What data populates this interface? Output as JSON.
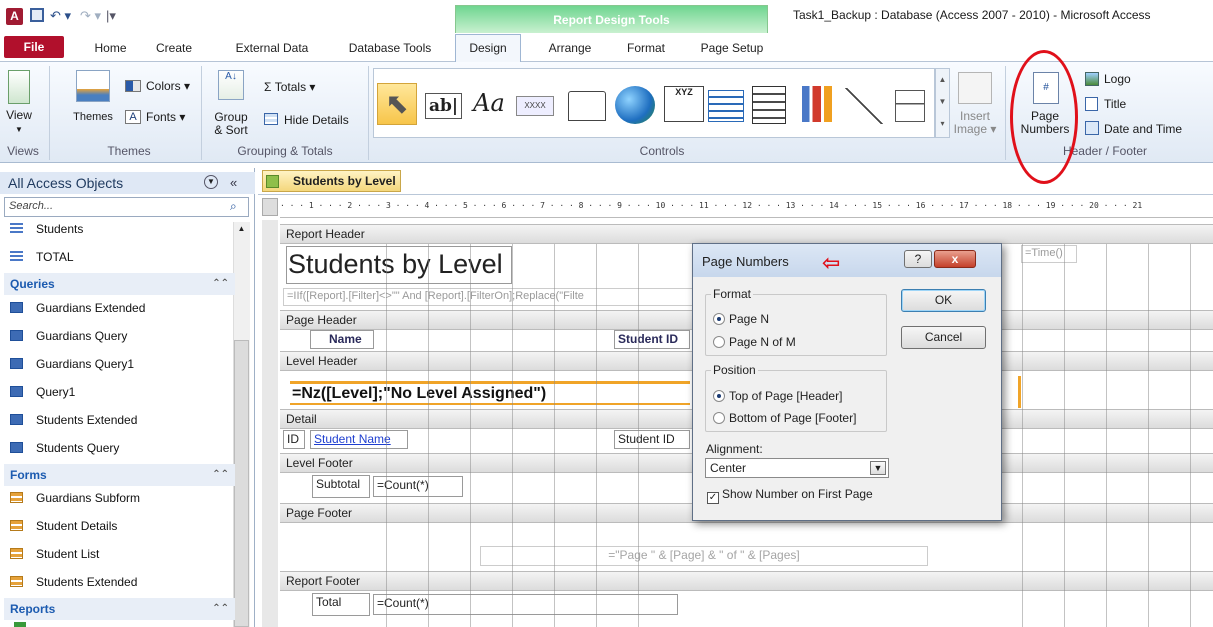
{
  "titlebar": {
    "app_icon": "access-app-icon",
    "qat_icons": [
      "save-icon",
      "undo-icon",
      "redo-icon",
      "customize-icon"
    ],
    "context_group": "Report Design Tools",
    "window_title": "Task1_Backup : Database (Access 2007 - 2010)  -  Microsoft Access"
  },
  "tabs": [
    "File",
    "Home",
    "Create",
    "External Data",
    "Database Tools",
    "Design",
    "Arrange",
    "Format",
    "Page Setup"
  ],
  "ribbon": {
    "views": {
      "view_label": "View",
      "group": "Views"
    },
    "themes": {
      "themes_label": "Themes",
      "colors_label": "Colors ▾",
      "fonts_label": "Fonts ▾",
      "group": "Themes"
    },
    "grouping": {
      "group_sort_label1": "Group",
      "group_sort_label2": "& Sort",
      "totals_label": "Σ Totals ▾",
      "hide_details_label": "Hide Details",
      "group": "Grouping & Totals"
    },
    "controls": {
      "textbox_label": "ab|",
      "label_label": "Aa",
      "button_label": "XXXX",
      "group": "Controls",
      "insert_image1": "Insert",
      "insert_image2": "Image ▾"
    },
    "header_footer": {
      "page_numbers1": "Page",
      "page_numbers2": "Numbers",
      "logo": "Logo",
      "title": "Title",
      "date_time": "Date and Time",
      "group": "Header / Footer"
    }
  },
  "nav": {
    "header": "All Access Objects",
    "search_placeholder": "Search...",
    "tables_items": [
      "Students",
      "TOTAL"
    ],
    "queries_label": "Queries",
    "queries_items": [
      "Guardians Extended",
      "Guardians Query",
      "Guardians Query1",
      "Query1",
      "Students Extended",
      "Students Query"
    ],
    "forms_label": "Forms",
    "forms_items": [
      "Guardians Subform",
      "Student Details",
      "Student List",
      "Students Extended"
    ],
    "reports_label": "Reports"
  },
  "document": {
    "tab_label": "Students by Level",
    "ruler_text": "· · · 1 · · · 2 · · · 3 · · · 4 · · · 5 · · · 6 · · · 7 · · · 8 · · · 9 · · · 10 · · · 11 · · · 12 · · · 13 · · · 14 · · · 15 · · · 16 · · · 17 · · · 18 · · · 19 · · · 20 · · · 21",
    "sections": {
      "report_header": "Report Header",
      "page_header": "Page Header",
      "level_header": "Level Header",
      "detail": "Detail",
      "level_footer": "Level Footer",
      "page_footer": "Page Footer",
      "report_footer": "Report Footer"
    },
    "report_title": "Students by Level",
    "filter_expr": "=IIf([Report].[Filter]<>\"\" And [Report].[FilterOn];Replace(\"Filte",
    "time_expr": "=Time()",
    "col_name": "Name",
    "col_student_id": "Student ID",
    "level_expr": "=Nz([Level];\"No Level Assigned\")",
    "detail_id": "ID",
    "detail_student_name": "Student Name",
    "detail_student_id": "Student ID",
    "subtotal_label": "Subtotal",
    "count_expr": "=Count(*)",
    "page_expr": "=\"Page \" & [Page] & \" of \" & [Pages]",
    "total_label": "Total",
    "total_count_expr": "=Count(*)"
  },
  "dialog": {
    "title": "Page Numbers",
    "help": "?",
    "close": "x",
    "format_legend": "Format",
    "format_options": [
      "Page N",
      "Page N of M"
    ],
    "position_legend": "Position",
    "position_options": [
      "Top of Page [Header]",
      "Bottom of Page [Footer]"
    ],
    "alignment_label": "Alignment:",
    "alignment_value": "Center",
    "show_first_page": "Show Number on First Page",
    "ok": "OK",
    "cancel": "Cancel",
    "format_selected": 0,
    "position_selected": 0,
    "show_first_page_checked": true
  },
  "annotation_color": "#e0101a"
}
